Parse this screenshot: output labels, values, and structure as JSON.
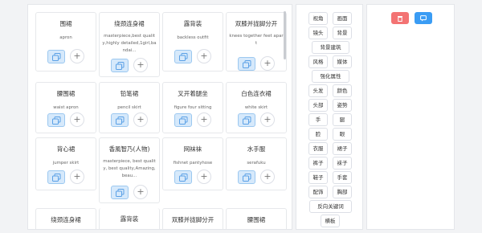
{
  "cards": [
    {
      "title": "围裙",
      "desc": "apron"
    },
    {
      "title": "绕颈连身裙",
      "desc": "masterpiece,best quality,highly detailed,1girl,bandai..."
    },
    {
      "title": "露背装",
      "desc": "backless outfit"
    },
    {
      "title": "双膝并拢脚分开",
      "desc": "knees together feet apart"
    },
    {
      "title": "腰围裙",
      "desc": "waist apron"
    },
    {
      "title": "铅笔裙",
      "desc": "pencil skirt"
    },
    {
      "title": "叉开着腿坐",
      "desc": "figure four sitting"
    },
    {
      "title": "白色连衣裙",
      "desc": "white skirt"
    },
    {
      "title": "背心裙",
      "desc": "jumper skirt"
    },
    {
      "title": "香風智乃(人物)",
      "desc": "masterpiece, best quality, best quality,Amazing,beau..."
    },
    {
      "title": "网袜袜",
      "desc": "fishnet pantyhose"
    },
    {
      "title": "水手服",
      "desc": "serafuku"
    },
    {
      "title": "绕颈连身裙",
      "desc": ""
    },
    {
      "title": "露背装",
      "desc": ""
    },
    {
      "title": "双膝并拢脚分开",
      "desc": ""
    },
    {
      "title": "腰围裙",
      "desc": ""
    }
  ],
  "tags": {
    "视角": "视角",
    "画面": "画面",
    "镜头": "镜头",
    "背景": "背景",
    "背景建筑": "背景建筑",
    "风格": "风格",
    "媒体": "媒体",
    "强化属性": "强化属性",
    "头发": "头发",
    "颜色": "颜色",
    "头部": "头部",
    "姿势": "姿势",
    "手": "手",
    "腿": "腿",
    "脸": "脸",
    "眼": "眼",
    "衣服": "衣服",
    "裙子": "裙子",
    "裤子": "裤子",
    "袜子": "袜子",
    "鞋子": "鞋子",
    "手套": "手套",
    "配饰": "配饰",
    "胸部": "胸部",
    "反向关键词": "反向关键词",
    "横板": "横板"
  },
  "colors": {
    "danger": "#f37373",
    "primary": "#3a9cf4",
    "copy_bg": "#d6e9fb"
  },
  "icons": {
    "copy": "copy-icon",
    "plus": "plus-icon",
    "trash": "trash-icon",
    "chat": "chat-icon"
  }
}
